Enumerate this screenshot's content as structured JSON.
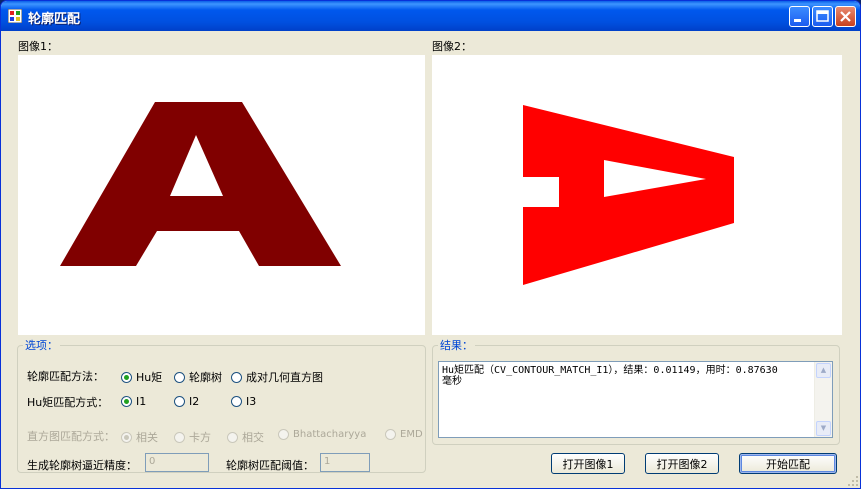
{
  "window": {
    "title": "轮廓匹配"
  },
  "images": {
    "image1_label": "图像1：",
    "image2_label": "图像2：",
    "glyph_letter": "A",
    "image1_color": "#800000",
    "image2_color": "#ff0000"
  },
  "options": {
    "group_label": "选项：",
    "method_label": "轮廓匹配方法：",
    "method_options": [
      "Hu矩",
      "轮廓树",
      "成对几何直方图"
    ],
    "method_selected": "Hu矩",
    "hu_mode_label": "Hu矩匹配方式：",
    "hu_modes": [
      "I1",
      "I2",
      "I3"
    ],
    "hu_mode_selected": "I1",
    "hist_mode_label": "直方图匹配方式：",
    "hist_modes": [
      "相关",
      "卡方",
      "相交",
      "Bhattacharyya",
      "EMD"
    ],
    "hist_mode_selected": "相关",
    "precision_label": "生成轮廓树逼近精度：",
    "precision_value": "0",
    "threshold_label": "轮廓树匹配阈值：",
    "threshold_value": "1"
  },
  "result": {
    "group_label": "结果：",
    "text": "Hu矩匹配（CV_CONTOUR_MATCH_I1），结果：0.01149，用时：0.87630\n毫秒"
  },
  "buttons": {
    "open_image1": "打开图像1",
    "open_image2": "打开图像2",
    "start_match": "开始匹配"
  }
}
